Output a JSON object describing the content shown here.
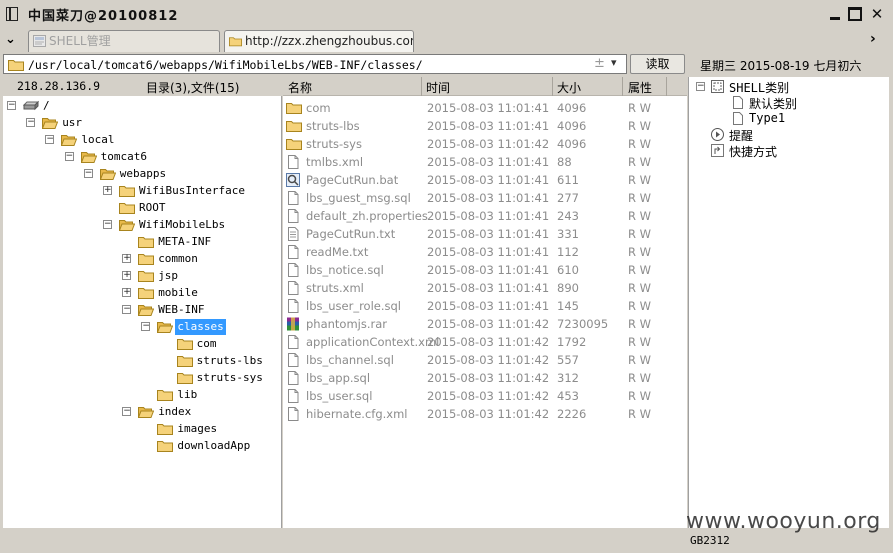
{
  "window": {
    "title": "中国菜刀@20100812"
  },
  "tabs": [
    {
      "label": "SHELL管理",
      "active": false
    },
    {
      "label": "http://zzx.zhengzhoubus.com/...",
      "active": true
    }
  ],
  "address": {
    "path": "/usr/local/tomcat6/webapps/WifiMobileLbs/WEB-INF/classes/",
    "read_label": "读取",
    "date": "星期三 2015-08-19 七月初六",
    "plus": "±",
    "dropdown": "▾"
  },
  "left_panel": {
    "ip": "218.28.136.9",
    "dir_count": "目录(3),文件(15)"
  },
  "tree": [
    {
      "label": "/",
      "depth": 0,
      "expander": "−",
      "icon": "drive-icon"
    },
    {
      "label": "usr",
      "depth": 1,
      "expander": "−",
      "icon": "folder-open-icon"
    },
    {
      "label": "local",
      "depth": 2,
      "expander": "−",
      "icon": "folder-open-icon"
    },
    {
      "label": "tomcat6",
      "depth": 3,
      "expander": "−",
      "icon": "folder-open-icon"
    },
    {
      "label": "webapps",
      "depth": 4,
      "expander": "−",
      "icon": "folder-open-icon"
    },
    {
      "label": "WifiBusInterface",
      "depth": 5,
      "expander": "+",
      "icon": "folder-icon"
    },
    {
      "label": "ROOT",
      "depth": 5,
      "expander": "",
      "icon": "folder-icon"
    },
    {
      "label": "WifiMobileLbs",
      "depth": 5,
      "expander": "−",
      "icon": "folder-open-icon"
    },
    {
      "label": "META-INF",
      "depth": 6,
      "expander": "",
      "icon": "folder-icon"
    },
    {
      "label": "common",
      "depth": 6,
      "expander": "+",
      "icon": "folder-icon"
    },
    {
      "label": "jsp",
      "depth": 6,
      "expander": "+",
      "icon": "folder-icon"
    },
    {
      "label": "mobile",
      "depth": 6,
      "expander": "+",
      "icon": "folder-icon"
    },
    {
      "label": "WEB-INF",
      "depth": 6,
      "expander": "−",
      "icon": "folder-open-icon"
    },
    {
      "label": "classes",
      "depth": 7,
      "expander": "−",
      "icon": "folder-open-icon",
      "selected": true
    },
    {
      "label": "com",
      "depth": 8,
      "expander": "",
      "icon": "folder-icon"
    },
    {
      "label": "struts-lbs",
      "depth": 8,
      "expander": "",
      "icon": "folder-icon"
    },
    {
      "label": "struts-sys",
      "depth": 8,
      "expander": "",
      "icon": "folder-icon"
    },
    {
      "label": "lib",
      "depth": 7,
      "expander": "",
      "icon": "folder-icon"
    },
    {
      "label": "index",
      "depth": 6,
      "expander": "−",
      "icon": "folder-open-icon"
    },
    {
      "label": "images",
      "depth": 7,
      "expander": "",
      "icon": "folder-icon"
    },
    {
      "label": "downloadApp",
      "depth": 7,
      "expander": "",
      "icon": "folder-icon"
    }
  ],
  "file_columns": {
    "name": "名称",
    "time": "时间",
    "size": "大小",
    "attr": "属性"
  },
  "files": [
    {
      "name": "com",
      "time": "2015-08-03 11:01:41",
      "size": "4096",
      "attr": "R W",
      "icon": "folder-icon"
    },
    {
      "name": "struts-lbs",
      "time": "2015-08-03 11:01:41",
      "size": "4096",
      "attr": "R W",
      "icon": "folder-icon"
    },
    {
      "name": "struts-sys",
      "time": "2015-08-03 11:01:42",
      "size": "4096",
      "attr": "R W",
      "icon": "folder-icon"
    },
    {
      "name": "tmlbs.xml",
      "time": "2015-08-03 11:01:41",
      "size": "88",
      "attr": "R W",
      "icon": "file-icon"
    },
    {
      "name": "PageCutRun.bat",
      "time": "2015-08-03 11:01:41",
      "size": "611",
      "attr": "R W",
      "icon": "bat-file-icon"
    },
    {
      "name": "lbs_guest_msg.sql",
      "time": "2015-08-03 11:01:41",
      "size": "277",
      "attr": "R W",
      "icon": "file-icon"
    },
    {
      "name": "default_zh.properties",
      "time": "2015-08-03 11:01:41",
      "size": "243",
      "attr": "R W",
      "icon": "file-icon"
    },
    {
      "name": "PageCutRun.txt",
      "time": "2015-08-03 11:01:41",
      "size": "331",
      "attr": "R W",
      "icon": "text-file-icon"
    },
    {
      "name": "readMe.txt",
      "time": "2015-08-03 11:01:41",
      "size": "112",
      "attr": "R W",
      "icon": "file-icon"
    },
    {
      "name": "lbs_notice.sql",
      "time": "2015-08-03 11:01:41",
      "size": "610",
      "attr": "R W",
      "icon": "file-icon"
    },
    {
      "name": "struts.xml",
      "time": "2015-08-03 11:01:41",
      "size": "890",
      "attr": "R W",
      "icon": "file-icon"
    },
    {
      "name": "lbs_user_role.sql",
      "time": "2015-08-03 11:01:41",
      "size": "145",
      "attr": "R W",
      "icon": "file-icon"
    },
    {
      "name": "phantomjs.rar",
      "time": "2015-08-03 11:01:42",
      "size": "7230095",
      "attr": "R W",
      "icon": "rar-file-icon"
    },
    {
      "name": "applicationContext.xml",
      "time": "2015-08-03 11:01:42",
      "size": "1792",
      "attr": "R W",
      "icon": "file-icon"
    },
    {
      "name": "lbs_channel.sql",
      "time": "2015-08-03 11:01:42",
      "size": "557",
      "attr": "R W",
      "icon": "file-icon"
    },
    {
      "name": "lbs_app.sql",
      "time": "2015-08-03 11:01:42",
      "size": "312",
      "attr": "R W",
      "icon": "file-icon"
    },
    {
      "name": "lbs_user.sql",
      "time": "2015-08-03 11:01:42",
      "size": "453",
      "attr": "R W",
      "icon": "file-icon"
    },
    {
      "name": "hibernate.cfg.xml",
      "time": "2015-08-03 11:01:42",
      "size": "2226",
      "attr": "R W",
      "icon": "file-icon"
    }
  ],
  "right_panel": {
    "shell_category": "SHELL类别",
    "default_category": "默认类别",
    "type1": "Type1",
    "reminder": "提醒",
    "shortcut": "快捷方式",
    "expander": "−"
  },
  "status": {
    "encoding": "GB2312"
  },
  "watermark": "www.wooyun.org",
  "colors": {
    "selection": "#3399ff",
    "folder": "#f5d27a",
    "muted_text": "#8c8c8c",
    "chrome": "#d4d0c8"
  }
}
